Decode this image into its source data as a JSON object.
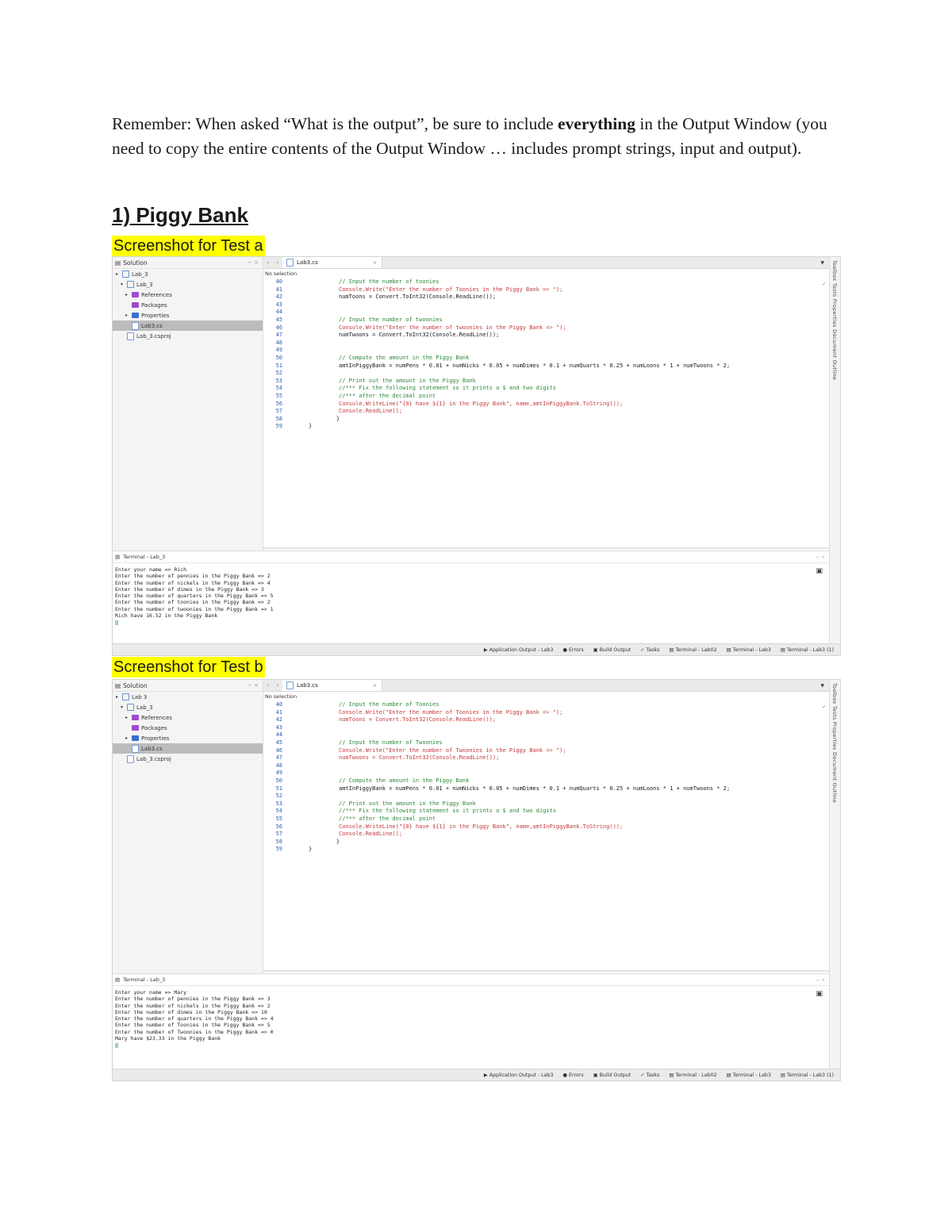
{
  "intro": {
    "part1": "Remember: When asked “What is the output”, be sure to include ",
    "bold": "everything",
    "part2": " in the  Output Window (you need to copy the entire contents of the Output Window … includes prompt strings, input and output)."
  },
  "heading": "1) Piggy Bank",
  "shots": [
    {
      "caption": "Screenshot for Test a",
      "solution_title": "Solution",
      "tree": [
        {
          "label": "Lab_3",
          "caret": "▸",
          "icon": "box",
          "indent": 0
        },
        {
          "label": "Lab_3",
          "caret": "▾",
          "icon": "box",
          "indent": 1
        },
        {
          "label": "References",
          "caret": "▸",
          "icon": "purple",
          "indent": 2
        },
        {
          "label": "Packages",
          "caret": "",
          "icon": "purple",
          "indent": 2
        },
        {
          "label": "Properties",
          "caret": "▸",
          "icon": "blue",
          "indent": 2
        },
        {
          "label": "Lab3.cs",
          "caret": "",
          "icon": "file",
          "indent": 2,
          "selected": true
        },
        {
          "label": "Lab_3.csproj",
          "caret": "",
          "icon": "file",
          "indent": 1
        }
      ],
      "tab_label": "Lab3.cs",
      "breadcrumb": "No selection",
      "code": [
        {
          "n": "40",
          "t": "// Input the number of toonies",
          "c": "cm"
        },
        {
          "n": "41",
          "t": "Console.Write(\"Enter the number of Toonies in the Piggy Bank => \");",
          "c": "str"
        },
        {
          "n": "42",
          "t": "numToons = Convert.ToInt32(Console.ReadLine());",
          "c": "kw"
        },
        {
          "n": "43",
          "t": "",
          "c": "kw"
        },
        {
          "n": "44",
          "t": "",
          "c": "kw"
        },
        {
          "n": "45",
          "t": "// Input the number of twoonies",
          "c": "cm"
        },
        {
          "n": "46",
          "t": "Console.Write(\"Enter the number of twoonies in the Piggy Bank => \");",
          "c": "str"
        },
        {
          "n": "47",
          "t": "numTwoons = Convert.ToInt32(Console.ReadLine());",
          "c": "kw"
        },
        {
          "n": "48",
          "t": "",
          "c": "kw"
        },
        {
          "n": "49",
          "t": "",
          "c": "kw"
        },
        {
          "n": "50",
          "t": "// Compute the amount in the Piggy Bank",
          "c": "cm"
        },
        {
          "n": "51",
          "t": "amtInPiggyBank = numPens * 0.01 + numNicks * 0.05 + numDimes * 0.1 + numQuarts * 0.25 + numLoons * 1 + numTwoons * 2;",
          "c": "kw"
        },
        {
          "n": "52",
          "t": "",
          "c": "kw"
        },
        {
          "n": "53",
          "t": "// Print out the amount in the Piggy Bank",
          "c": "cm"
        },
        {
          "n": "54",
          "t": "//*** Fix the following statement so it prints a $ and two digits",
          "c": "cm"
        },
        {
          "n": "55",
          "t": "//*** after the decimal point",
          "c": "cm"
        },
        {
          "n": "56",
          "t": "Console.WriteLine(\"{0} have ${1} in the Piggy Bank\", name,amtInPiggyBank.ToString());",
          "c": "str"
        },
        {
          "n": "57",
          "t": "Console.ReadLine();",
          "c": "str"
        },
        {
          "n": "58",
          "t": "    }",
          "c": "kw",
          "shift": -20
        },
        {
          "n": "59",
          "t": "}",
          "c": "kw",
          "shift": -38
        }
      ],
      "terminal_title": "Terminal - Lab_3",
      "terminal": [
        "Enter your name => Rich",
        "Enter the number of pennies in the Piggy Bank => 2",
        "Enter the number of nickels in the Piggy Bank => 4",
        "Enter the number of dimes in the Piggy Bank => 3",
        "Enter the number of quarters in the Piggy Bank => 5",
        "Enter the number of toonies in the Piggy Bank => 2",
        "Enter the number of twoonies in the Piggy Bank => 1",
        "Rich have 16.52 in the Piggy Bank"
      ],
      "status": [
        "Application Output - Lab3",
        "Errors",
        "Build Output",
        "Tasks",
        "Terminal - Lab02",
        "Terminal - Lab3",
        "Terminal - Lab3 (1)"
      ],
      "side_tabs": "Toolbox    Tests    Properties    Document Outline"
    },
    {
      "caption": "Screenshot for Test b",
      "solution_title": "Solution",
      "tree": [
        {
          "label": "Lab 3",
          "caret": "▸",
          "icon": "box",
          "indent": 0
        },
        {
          "label": "Lab_3",
          "caret": "▾",
          "icon": "box",
          "indent": 1
        },
        {
          "label": "References",
          "caret": "▸",
          "icon": "purple",
          "indent": 2
        },
        {
          "label": "Packages",
          "caret": "",
          "icon": "purple",
          "indent": 2
        },
        {
          "label": "Properties",
          "caret": "▸",
          "icon": "blue",
          "indent": 2
        },
        {
          "label": "Lab3.cs",
          "caret": "",
          "icon": "file",
          "indent": 2,
          "selected": true
        },
        {
          "label": "Lab_3.csproj",
          "caret": "",
          "icon": "file",
          "indent": 1
        }
      ],
      "tab_label": "Lab3.cs",
      "breadcrumb": "No selection",
      "code": [
        {
          "n": "40",
          "t": "// Input the number of Toonies",
          "c": "cm"
        },
        {
          "n": "41",
          "t": "Console.Write(\"Enter the number of Toonies in the Piggy Bank => \");",
          "c": "str"
        },
        {
          "n": "42",
          "t": "numToons = Convert.ToInt32(Console.ReadLine());",
          "c": "str"
        },
        {
          "n": "43",
          "t": "",
          "c": "kw"
        },
        {
          "n": "44",
          "t": "",
          "c": "kw"
        },
        {
          "n": "45",
          "t": "// Input the number of Twoonies",
          "c": "cm"
        },
        {
          "n": "46",
          "t": "Console.Write(\"Enter the number of Twoonies in the Piggy Bank => \");",
          "c": "str"
        },
        {
          "n": "47",
          "t": "numTwoons = Convert.ToInt32(Console.ReadLine());",
          "c": "str"
        },
        {
          "n": "48",
          "t": "",
          "c": "kw"
        },
        {
          "n": "49",
          "t": "",
          "c": "kw"
        },
        {
          "n": "50",
          "t": "// Compute the amount in the Piggy Bank",
          "c": "cm"
        },
        {
          "n": "51",
          "t": "amtInPiggyBank = numPens * 0.01 + numNicks * 0.05 + numDimes * 0.1 + numQuarts * 0.25 + numLoons * 1 + numTwoons * 2;",
          "c": "kw"
        },
        {
          "n": "52",
          "t": "",
          "c": "kw"
        },
        {
          "n": "53",
          "t": "// Print out the amount in the Piggy Bank",
          "c": "cm"
        },
        {
          "n": "54",
          "t": "//*** Fix the following statement so it prints a $ and two digits",
          "c": "cm"
        },
        {
          "n": "55",
          "t": "//*** after the decimal point",
          "c": "cm"
        },
        {
          "n": "56",
          "t": "Console.WriteLine(\"{0} have ${1} in the Piggy Bank\", name,amtInPiggyBank.ToString());",
          "c": "str"
        },
        {
          "n": "57",
          "t": "Console.ReadLine();",
          "c": "str"
        },
        {
          "n": "58",
          "t": "    }",
          "c": "kw",
          "shift": -20
        },
        {
          "n": "59",
          "t": "}",
          "c": "kw",
          "shift": -38
        }
      ],
      "terminal_title": "Terminal - Lab_3",
      "terminal": [
        "Enter your name => Mary",
        "Enter the number of pennies in the Piggy Bank => 3",
        "Enter the number of nickels in the Piggy Bank => 2",
        "Enter the number of dimes in the Piggy Bank => 10",
        "Enter the number of quarters in the Piggy Bank => 4",
        "Enter the number of Toonies in the Piggy Bank => 5",
        "Enter the number of Twoonies in the Piggy Bank => 0",
        "Mary have $23.33 in the Piggy Bank"
      ],
      "status": [
        "Application Output - Lab3",
        "Errors",
        "Build Output",
        "Tasks",
        "Terminal - Lab02",
        "Terminal - Lab3",
        "Terminal - Lab3 (1)"
      ],
      "side_tabs": "Toolbox    Tests    Properties    Document Outline"
    }
  ]
}
